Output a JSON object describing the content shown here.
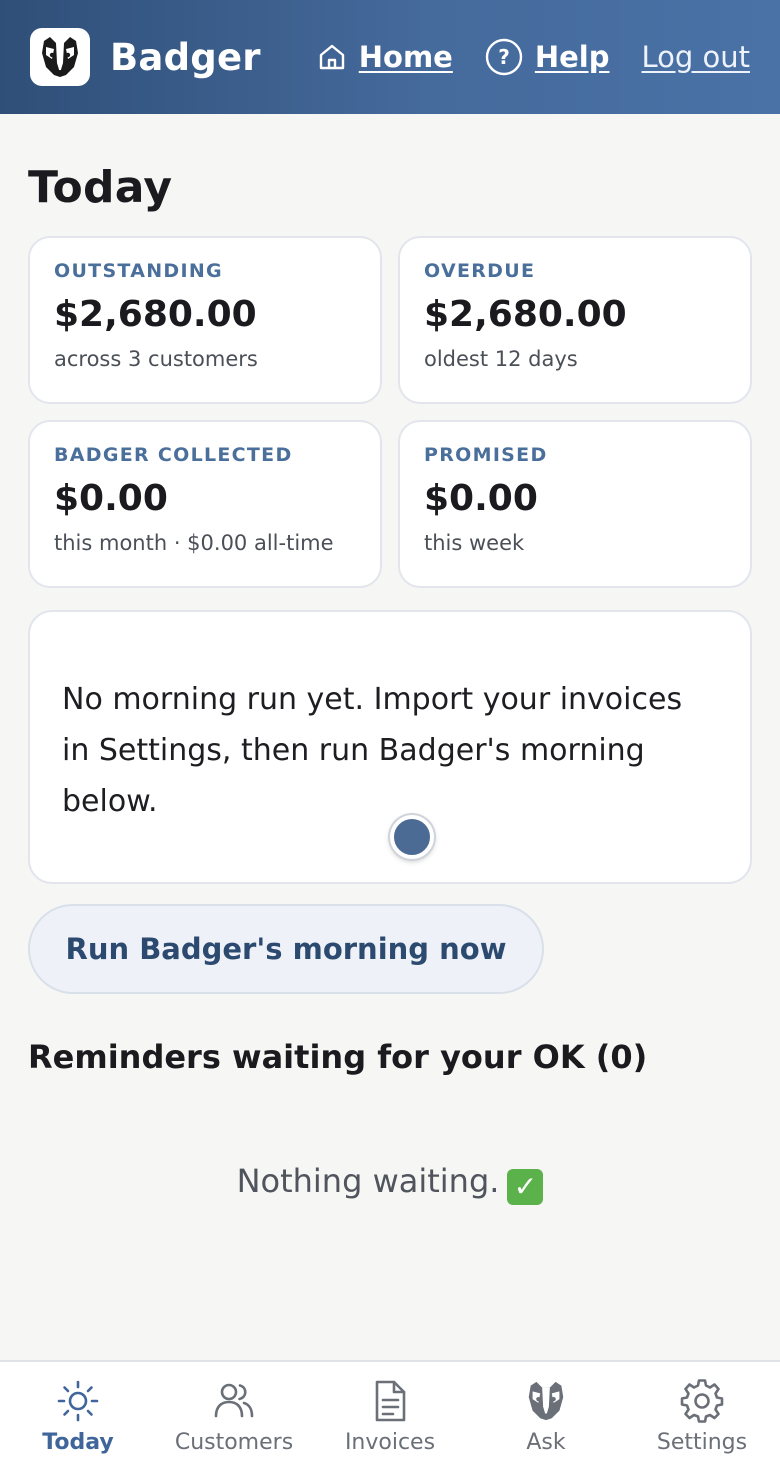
{
  "header": {
    "brand": "Badger",
    "nav": {
      "home": "Home",
      "help": "Help",
      "logout": "Log out"
    },
    "gradient_start": "#2f4f78",
    "gradient_end": "#4a72a6"
  },
  "page": {
    "title": "Today"
  },
  "stats": [
    {
      "label": "OUTSTANDING",
      "value": "$2,680.00",
      "sub": "across 3 customers"
    },
    {
      "label": "OVERDUE",
      "value": "$2,680.00",
      "sub": "oldest 12 days"
    },
    {
      "label": "BADGER COLLECTED",
      "value": "$0.00",
      "sub": "this month · $0.00 all-time"
    },
    {
      "label": "PROMISED",
      "value": "$0.00",
      "sub": "this week"
    }
  ],
  "morning": {
    "message": "No morning run yet. Import your invoices in Settings, then run Badger's morning below.",
    "run_button": "Run Badger's morning now"
  },
  "reminders": {
    "title": "Reminders waiting for your OK (0)",
    "empty": "Nothing waiting.",
    "empty_emoji": "✓"
  },
  "bottom_nav": {
    "today": "Today",
    "customers": "Customers",
    "invoices": "Invoices",
    "ask": "Ask",
    "settings": "Settings"
  },
  "colors": {
    "accent": "#3f659a",
    "label": "#4a6f9b",
    "background": "#f6f6f4"
  }
}
